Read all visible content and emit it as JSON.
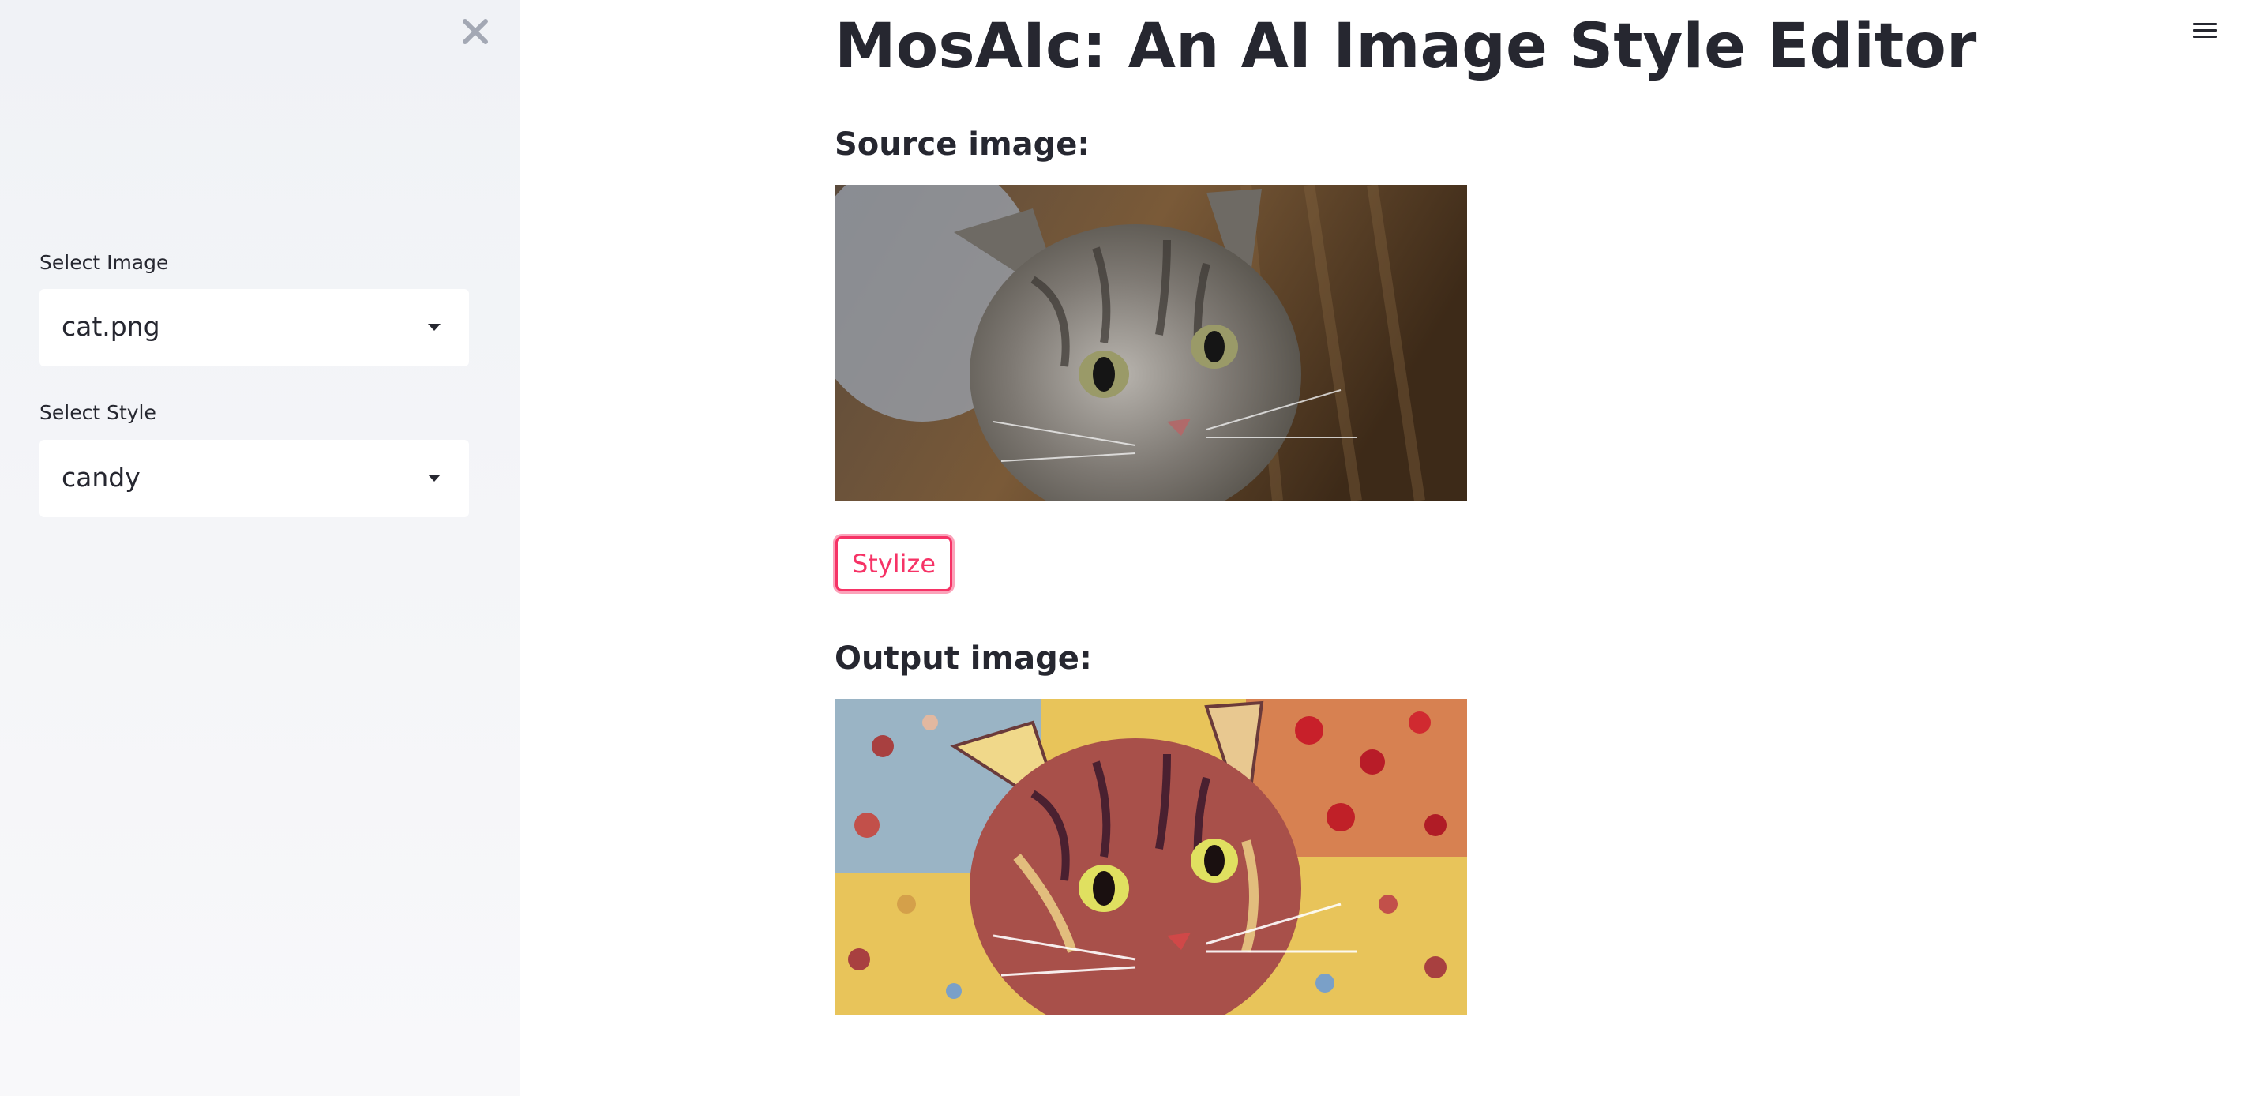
{
  "app": {
    "title": "MosAIc: An AI Image Style Editor"
  },
  "sidebar": {
    "close_icon": "close-icon",
    "image_select": {
      "label": "Select Image",
      "value": "cat.png"
    },
    "style_select": {
      "label": "Select Style",
      "value": "candy"
    }
  },
  "main": {
    "menu_icon": "hamburger-menu-icon",
    "source_heading": "Source image:",
    "stylize_label": "Stylize",
    "output_heading": "Output image:"
  },
  "colors": {
    "accent": "#f63366",
    "sidebar_bg": "#f0f2f6",
    "text": "#262730"
  }
}
